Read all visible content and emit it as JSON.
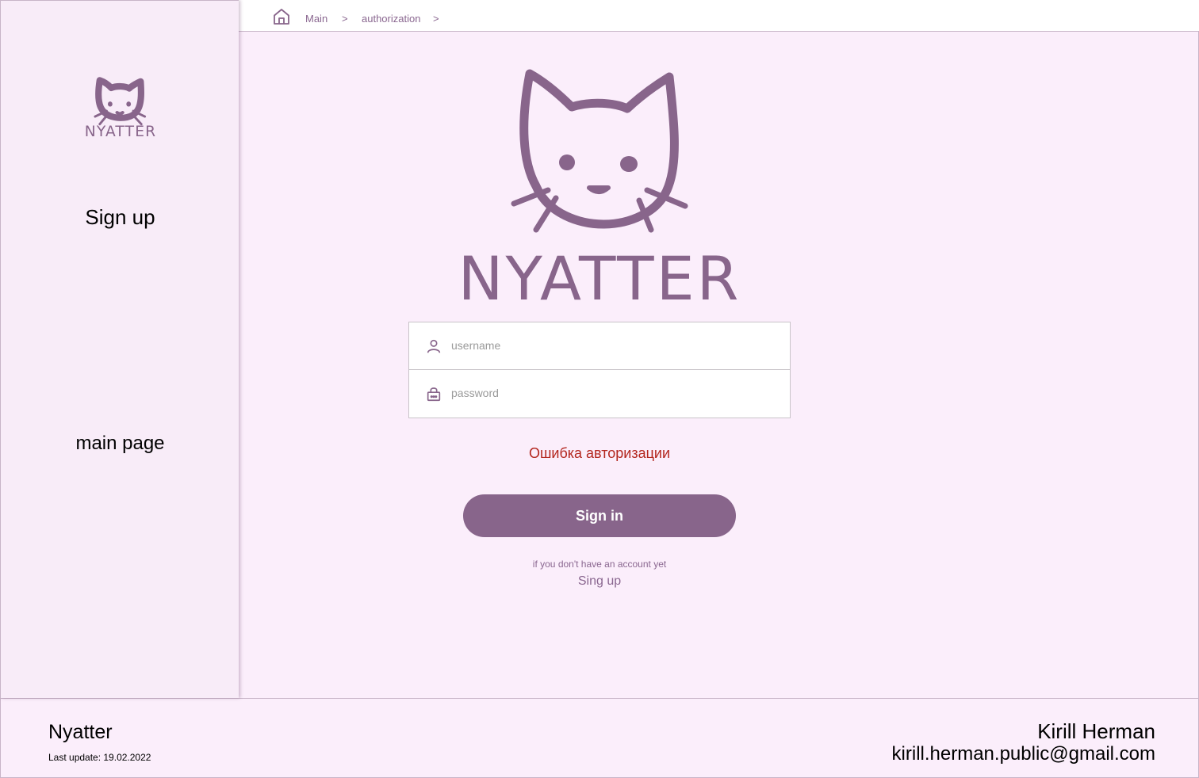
{
  "app": {
    "logo_text": "NYATTER",
    "accent_color": "#88658b",
    "error_color": "#b3261e"
  },
  "sidebar": {
    "signup_label": "Sign up",
    "main_page_label": "main page"
  },
  "breadcrumb": {
    "home_icon": "home-icon",
    "items": [
      {
        "label": "Main"
      },
      {
        "label": "authorization"
      }
    ],
    "separator": ">"
  },
  "login_form": {
    "username": {
      "placeholder": "username",
      "value": "",
      "icon": "user-icon"
    },
    "password": {
      "placeholder": "password",
      "value": "",
      "icon": "lock-icon"
    },
    "error_message": "Ошибка авторизации",
    "submit_label": "Sign in",
    "no_account_hint": "if you don't have an account yet",
    "signup_link_label": "Sing up"
  },
  "footer": {
    "brand": "Nyatter",
    "last_update": "Last update: 19.02.2022",
    "author_name": "Kirill Herman",
    "author_email": "kirill.herman.public@gmail.com"
  }
}
